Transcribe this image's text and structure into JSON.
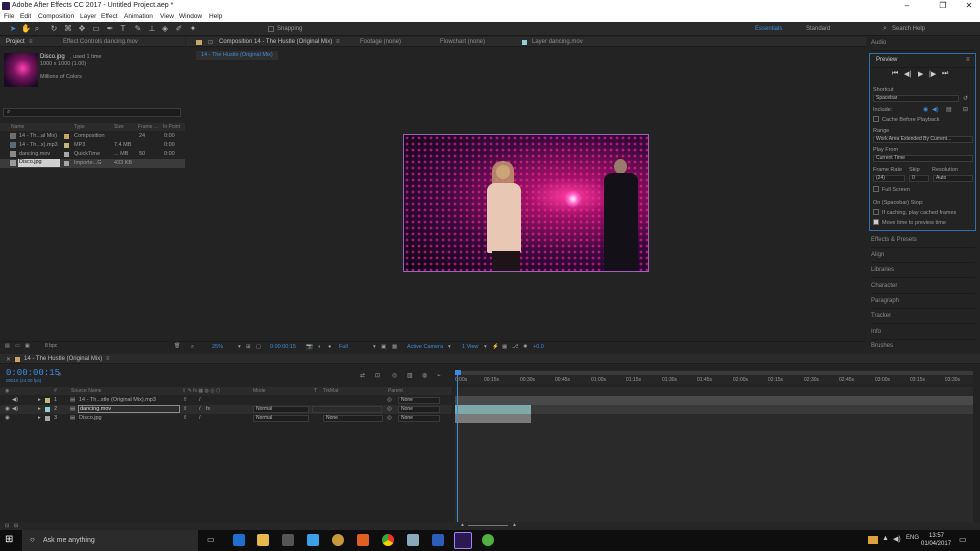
{
  "app": {
    "title": "Adobe After Effects CC 2017 - Untitled Project.aep *"
  },
  "menu": [
    "File",
    "Edit",
    "Composition",
    "Layer",
    "Effect",
    "Animation",
    "View",
    "Window",
    "Help"
  ],
  "toolbar": {
    "snapping": "Snapping",
    "workspaces": [
      "Essentials",
      "Standard"
    ],
    "search_placeholder": "Search Help"
  },
  "project": {
    "tabs": [
      "Project",
      "Effect Controls dancing.mov"
    ],
    "selected": {
      "name": "Disco.jpg",
      "usage": ", used 1 time",
      "size": "1000 x 1000 (1.00)",
      "colors": "Millions of Colors"
    },
    "columns": [
      "Name",
      "Type",
      "Size",
      "Frame ...",
      "In Point"
    ],
    "items": [
      {
        "name": "14 - Th...al Mix)",
        "type": "Composition",
        "size": "",
        "rate": "24",
        "in": "0:00"
      },
      {
        "name": "14 - Th...x).mp3",
        "type": "MP3",
        "size": "7.4 MB",
        "rate": "",
        "in": "0:00"
      },
      {
        "name": "dancing.mov",
        "type": "QuickTime",
        "size": "... MB",
        "rate": "50",
        "in": "0:00"
      },
      {
        "name": "Disco.jpg",
        "type": "Importe...G",
        "size": "433 KB",
        "rate": "",
        "in": ""
      }
    ],
    "bpc": "8 bpc"
  },
  "viewer": {
    "tabs": [
      "Composition 14 - The Hustle (Original Mix)",
      "Footage (none)",
      "Flowchart (none)",
      "Layer dancing.mov"
    ],
    "breadcrumb": "14 - The Hustle (Original Mix)",
    "zoom": "25%",
    "timecode": "0:00:00:15",
    "resolution": "Full",
    "camera": "Active Camera",
    "views": "1 View",
    "exposure": "+0.0"
  },
  "right": {
    "audio": "Audio",
    "preview": "Preview",
    "shortcut_label": "Shortcut",
    "shortcut": "Spacebar",
    "include": "Include:",
    "cache": "Cache Before Playback",
    "range_label": "Range",
    "range": "Work Area Extended By Current...",
    "playfrom_label": "Play From",
    "playfrom": "Current Time",
    "fr_label": "Frame Rate",
    "skip_label": "Skip",
    "res_label": "Resolution",
    "fr": "(24)",
    "skip": "0",
    "res": "Auto",
    "fullscreen": "Full Screen",
    "stop_label": "On (Spacebar) Stop:",
    "stop1": "If caching, play cached frames",
    "stop2": "Move time to preview time",
    "sections": [
      "Effects & Presets",
      "Align",
      "Libraries",
      "Character",
      "Paragraph",
      "Tracker",
      "Info",
      "Brushes"
    ]
  },
  "timeline": {
    "tab": "14 - The Hustle (Original Mix)",
    "timecode": "0:00:00:15",
    "frames": "00015 (24.00 fps)",
    "cols": {
      "num": "#",
      "source": "Source Name",
      "mode": "Mode",
      "t": "T",
      "trkmat": "TrkMat",
      "parent": "Parent"
    },
    "layers": [
      {
        "num": "1",
        "name": "14 - Th...stle (Original Mix).mp3",
        "mode": "",
        "trk": "",
        "parent": "None"
      },
      {
        "num": "2",
        "name": "dancing.mov",
        "mode": "Normal",
        "trk": "",
        "parent": "None"
      },
      {
        "num": "3",
        "name": "Disco.jpg",
        "mode": "Normal",
        "trk": "None",
        "parent": "None"
      }
    ],
    "ruler": [
      "0:00s",
      "00:15s",
      "00:30s",
      "00:45s",
      "01:00s",
      "01:15s",
      "01:30s",
      "01:45s",
      "02:00s",
      "02:15s",
      "02:30s",
      "02:45s",
      "03:00s",
      "03:15s",
      "03:30s"
    ]
  },
  "taskbar": {
    "search": "Ask me anything",
    "time": "13:57",
    "date": "01/04/2017"
  },
  "colors": {
    "accent": "#3d8cdc",
    "title_blue": "#2d8ceb"
  }
}
